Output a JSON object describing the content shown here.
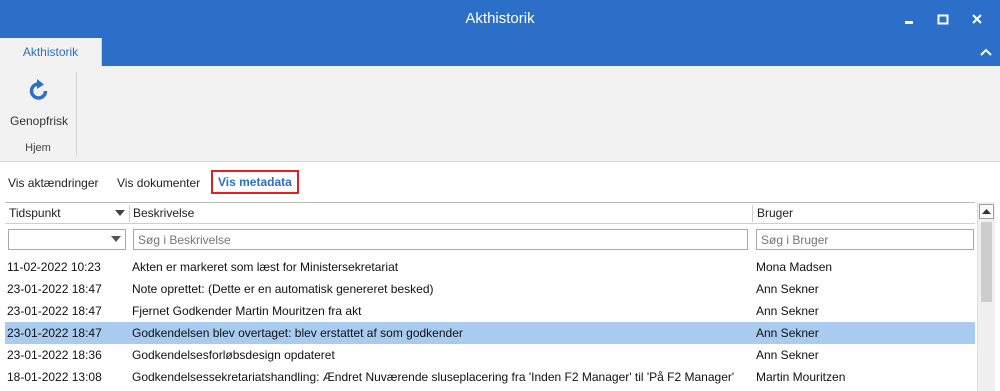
{
  "window": {
    "title": "Akthistorik"
  },
  "ribbon": {
    "tab_label": "Akthistorik",
    "refresh_label": "Genopfrisk",
    "group_label": "Hjem"
  },
  "view_tabs": [
    {
      "label": "Vis aktændringer",
      "active": false
    },
    {
      "label": "Vis dokumenter",
      "active": false
    },
    {
      "label": "Vis metadata",
      "active": true
    }
  ],
  "columns": {
    "time": "Tidspunkt",
    "description": "Beskrivelse",
    "user": "Bruger"
  },
  "filters": {
    "description_placeholder": "Søg i Beskrivelse",
    "user_placeholder": "Søg i Bruger"
  },
  "rows": [
    {
      "time": "11-02-2022 10:23",
      "description": "Akten er markeret som læst for Ministersekretariat",
      "user": "Mona Madsen"
    },
    {
      "time": "23-01-2022 18:47",
      "description": "Note oprettet: (Dette er en automatisk genereret besked)",
      "user": "Ann Sekner"
    },
    {
      "time": "23-01-2022 18:47",
      "description": "Fjernet Godkender Martin Mouritzen fra akt",
      "user": "Ann Sekner"
    },
    {
      "time": "23-01-2022 18:47",
      "description": "Godkendelsen blev overtaget:  blev erstattet af  som godkender",
      "user": "Ann Sekner",
      "selected": true
    },
    {
      "time": "23-01-2022 18:36",
      "description": "Godkendelsesforløbsdesign opdateret",
      "user": "Ann Sekner"
    },
    {
      "time": "18-01-2022 13:08",
      "description": "Godkendelsessekretariatshandling: Ændret Nuværende sluseplacering fra 'Inden F2 Manager' til 'På F2 Manager'",
      "user": "Martin Mouritzen"
    }
  ],
  "colors": {
    "accent": "#2b6fc9",
    "selected_row": "#a9cbef",
    "highlight_box": "#e02020"
  }
}
